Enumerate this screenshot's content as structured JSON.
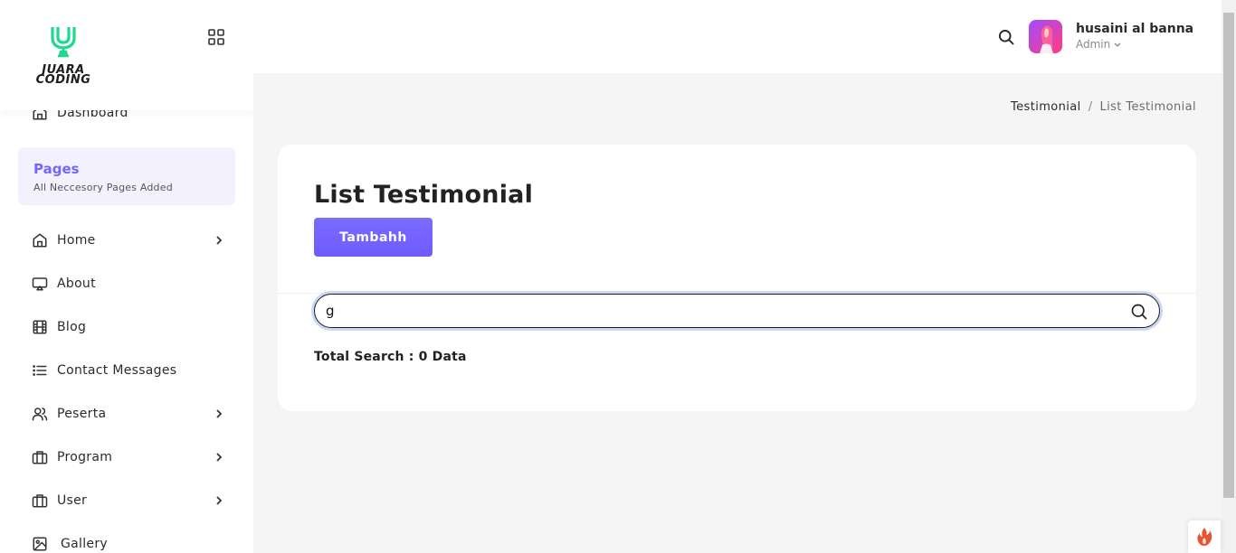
{
  "brand": {
    "line1": "JUARA",
    "line2": "CODING",
    "accent": "#1ed98f"
  },
  "sidebar": {
    "dashboard_label": "Dashboard",
    "pages_title": "Pages",
    "pages_subtitle": "All Neccesory Pages Added",
    "items": [
      {
        "label": "Home",
        "icon": "home-icon",
        "has_submenu": true
      },
      {
        "label": "About",
        "icon": "monitor-icon",
        "has_submenu": false
      },
      {
        "label": "Blog",
        "icon": "film-icon",
        "has_submenu": false
      },
      {
        "label": "Contact Messages",
        "icon": "list-icon",
        "has_submenu": false
      },
      {
        "label": "Peserta",
        "icon": "users-icon",
        "has_submenu": true
      },
      {
        "label": "Program",
        "icon": "briefcase-icon",
        "has_submenu": true
      },
      {
        "label": "User",
        "icon": "briefcase-icon",
        "has_submenu": true
      },
      {
        "label": "Gallery",
        "icon": "image-icon",
        "has_submenu": false
      }
    ]
  },
  "header": {
    "user_name": "husaini al banna",
    "user_role": "Admin"
  },
  "breadcrumb": {
    "parent": "Testimonial",
    "separator": "/",
    "current": "List Testimonial"
  },
  "main": {
    "title": "List Testimonial",
    "add_button": "Tambahh",
    "search_value": "g",
    "total_text": "Total Search : 0 Data"
  },
  "colors": {
    "primary": "#7366ff",
    "page_bg": "#f5f5f5",
    "pages_box_bg": "#f3f1fe"
  }
}
